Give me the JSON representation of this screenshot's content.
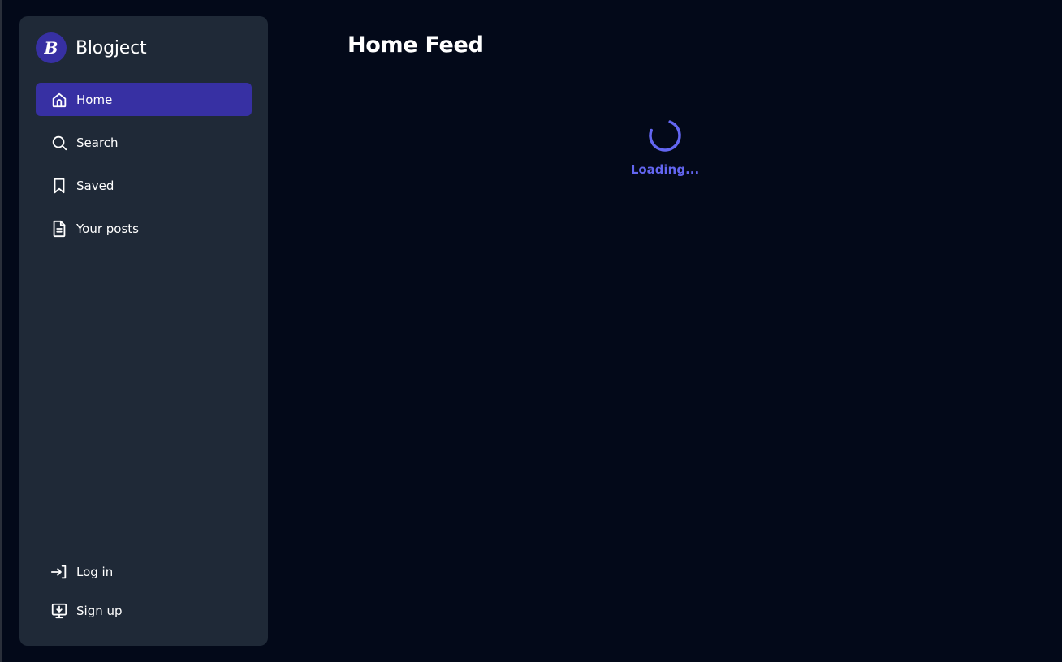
{
  "brand": {
    "logo_letter": "B",
    "name": "Blogject"
  },
  "sidebar": {
    "items": [
      {
        "label": "Home",
        "icon": "home-icon",
        "active": true
      },
      {
        "label": "Search",
        "icon": "search-icon",
        "active": false
      },
      {
        "label": "Saved",
        "icon": "bookmark-icon",
        "active": false
      },
      {
        "label": "Your posts",
        "icon": "document-icon",
        "active": false
      }
    ],
    "bottom_items": [
      {
        "label": "Log in",
        "icon": "login-icon"
      },
      {
        "label": "Sign up",
        "icon": "signup-icon"
      }
    ]
  },
  "main": {
    "title": "Home Feed",
    "loading_text": "Loading..."
  },
  "colors": {
    "background": "#030919",
    "sidebar_bg": "#1f2937",
    "accent": "#3730a3",
    "loader": "#6366f1"
  }
}
